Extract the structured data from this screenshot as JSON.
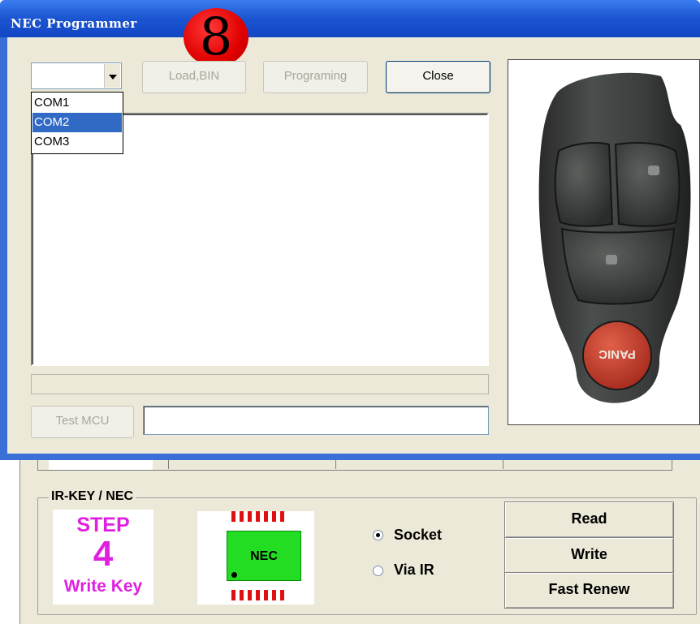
{
  "background_app": {
    "group_title": "IR-KEY / NEC",
    "step_badge": {
      "line1": "STEP",
      "line2": "4",
      "line3": "Write Key"
    },
    "chip_label": "NEC",
    "radios": [
      {
        "label": "Socket",
        "checked": true
      },
      {
        "label": "Via IR",
        "checked": false
      }
    ],
    "buttons": {
      "read": "Read",
      "write": "Write",
      "fast_renew": "Fast Renew"
    }
  },
  "dialog": {
    "title": "NEC Programmer",
    "badge_number": "8",
    "buttons": {
      "load": "Load,BIN",
      "programing": "Programing",
      "close": "Close",
      "test_mcu": "Test MCU"
    },
    "com_select": {
      "value": "",
      "options": [
        "COM1",
        "COM2",
        "COM3"
      ],
      "highlighted": "COM2"
    },
    "test_input_value": "",
    "image_caption": "PANIC"
  },
  "colors": {
    "title_bar": "#1b54d0",
    "selection": "#316ac5",
    "step_text": "#e020e0",
    "chip_green": "#22dd22",
    "chip_pins": "#e01010",
    "badge_red": "#e00000"
  }
}
